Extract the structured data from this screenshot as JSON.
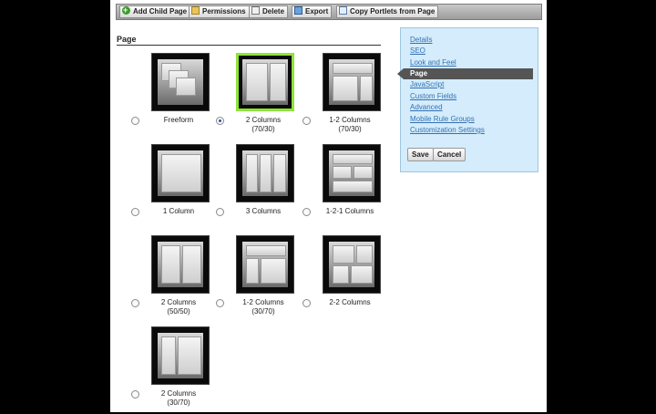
{
  "toolbar": {
    "add_child_page": "Add Child Page",
    "permissions": "Permissions",
    "delete": "Delete",
    "export": "Export",
    "copy_portlets": "Copy Portlets from Page"
  },
  "section_title": "Page",
  "layouts": [
    {
      "line1": "Freeform",
      "line2": "",
      "selected": false
    },
    {
      "line1": "2 Columns",
      "line2": "(70/30)",
      "selected": true
    },
    {
      "line1": "1-2 Columns",
      "line2": "(70/30)",
      "selected": false
    },
    {
      "line1": "1 Column",
      "line2": "",
      "selected": false
    },
    {
      "line1": "3 Columns",
      "line2": "",
      "selected": false
    },
    {
      "line1": "1-2-1 Columns",
      "line2": "",
      "selected": false
    },
    {
      "line1": "2 Columns",
      "line2": "(50/50)",
      "selected": false
    },
    {
      "line1": "1-2 Columns",
      "line2": "(30/70)",
      "selected": false
    },
    {
      "line1": "2-2 Columns",
      "line2": "",
      "selected": false
    },
    {
      "line1": "2 Columns",
      "line2": "(30/70)",
      "selected": false
    }
  ],
  "sidebar": {
    "items": [
      "Details",
      "SEO",
      "Look and Feel",
      "Page",
      "JavaScript",
      "Custom Fields",
      "Advanced",
      "Mobile Rule Groups",
      "Customization Settings"
    ],
    "active": "Page",
    "save_label": "Save",
    "cancel_label": "Cancel"
  },
  "colors": {
    "selected_border": "#8fe33a",
    "sidebar_bg": "#d4ecfb",
    "link": "#3371b3"
  }
}
